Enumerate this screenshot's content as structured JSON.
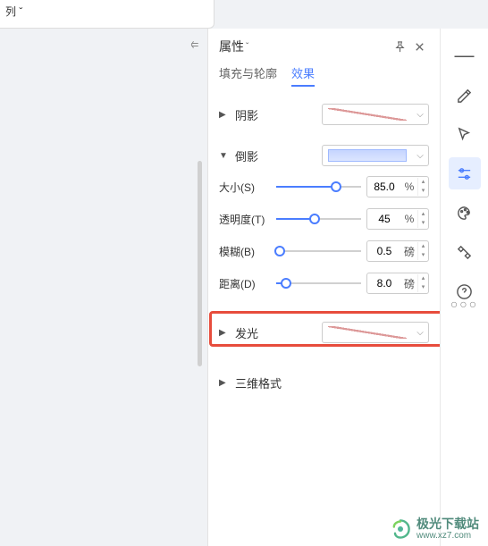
{
  "topleft": {
    "text": "列 ˇ"
  },
  "panel": {
    "title": "属性",
    "tabs": {
      "fill_outline": "填充与轮廓",
      "effects": "效果"
    }
  },
  "sections": {
    "shadow": {
      "label": "阴影"
    },
    "reflection": {
      "label": "倒影",
      "size": {
        "label": "大小(S)",
        "value": "85.0",
        "unit": "%",
        "pos": 71
      },
      "opacity": {
        "label": "透明度(T)",
        "value": "45",
        "unit": "%",
        "pos": 45
      },
      "blur": {
        "label": "模糊(B)",
        "value": "0.5",
        "unit": "磅",
        "pos": 4
      },
      "distance": {
        "label": "距离(D)",
        "value": "8.0",
        "unit": "磅",
        "pos": 12
      }
    },
    "glow": {
      "label": "发光"
    },
    "threed": {
      "label": "三维格式"
    }
  },
  "watermark": {
    "cn": "极光下载站",
    "url": "www.xz7.com"
  }
}
